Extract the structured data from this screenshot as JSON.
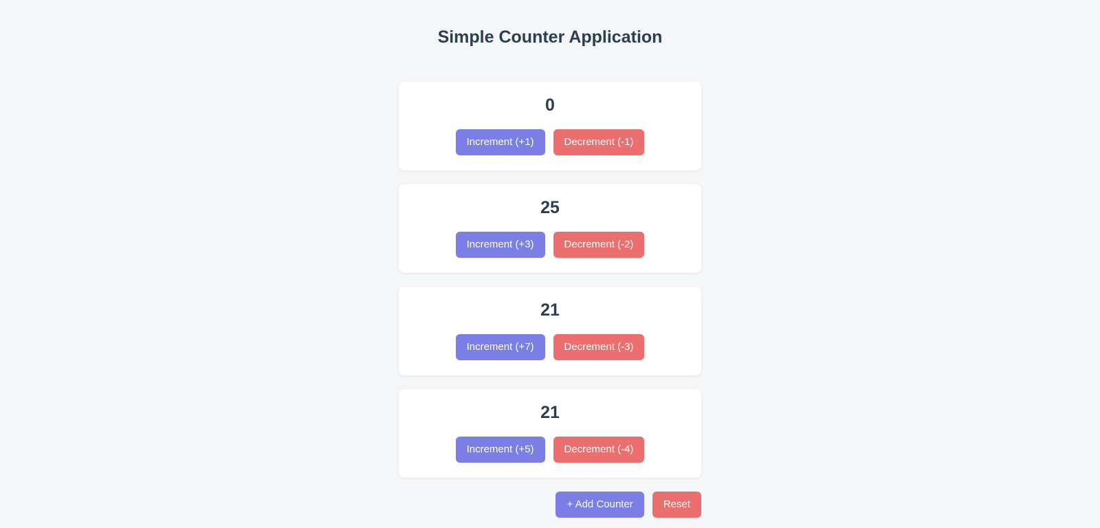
{
  "page": {
    "title": "Simple Counter Application"
  },
  "counters": [
    {
      "value": "0",
      "increment_label": "Increment (+1)",
      "decrement_label": "Decrement (-1)"
    },
    {
      "value": "25",
      "increment_label": "Increment (+3)",
      "decrement_label": "Decrement (-2)"
    },
    {
      "value": "21",
      "increment_label": "Increment (+7)",
      "decrement_label": "Decrement (-3)"
    },
    {
      "value": "21",
      "increment_label": "Increment (+5)",
      "decrement_label": "Decrement (-4)"
    }
  ],
  "footer": {
    "add_label": "+ Add Counter",
    "reset_label": "Reset"
  }
}
